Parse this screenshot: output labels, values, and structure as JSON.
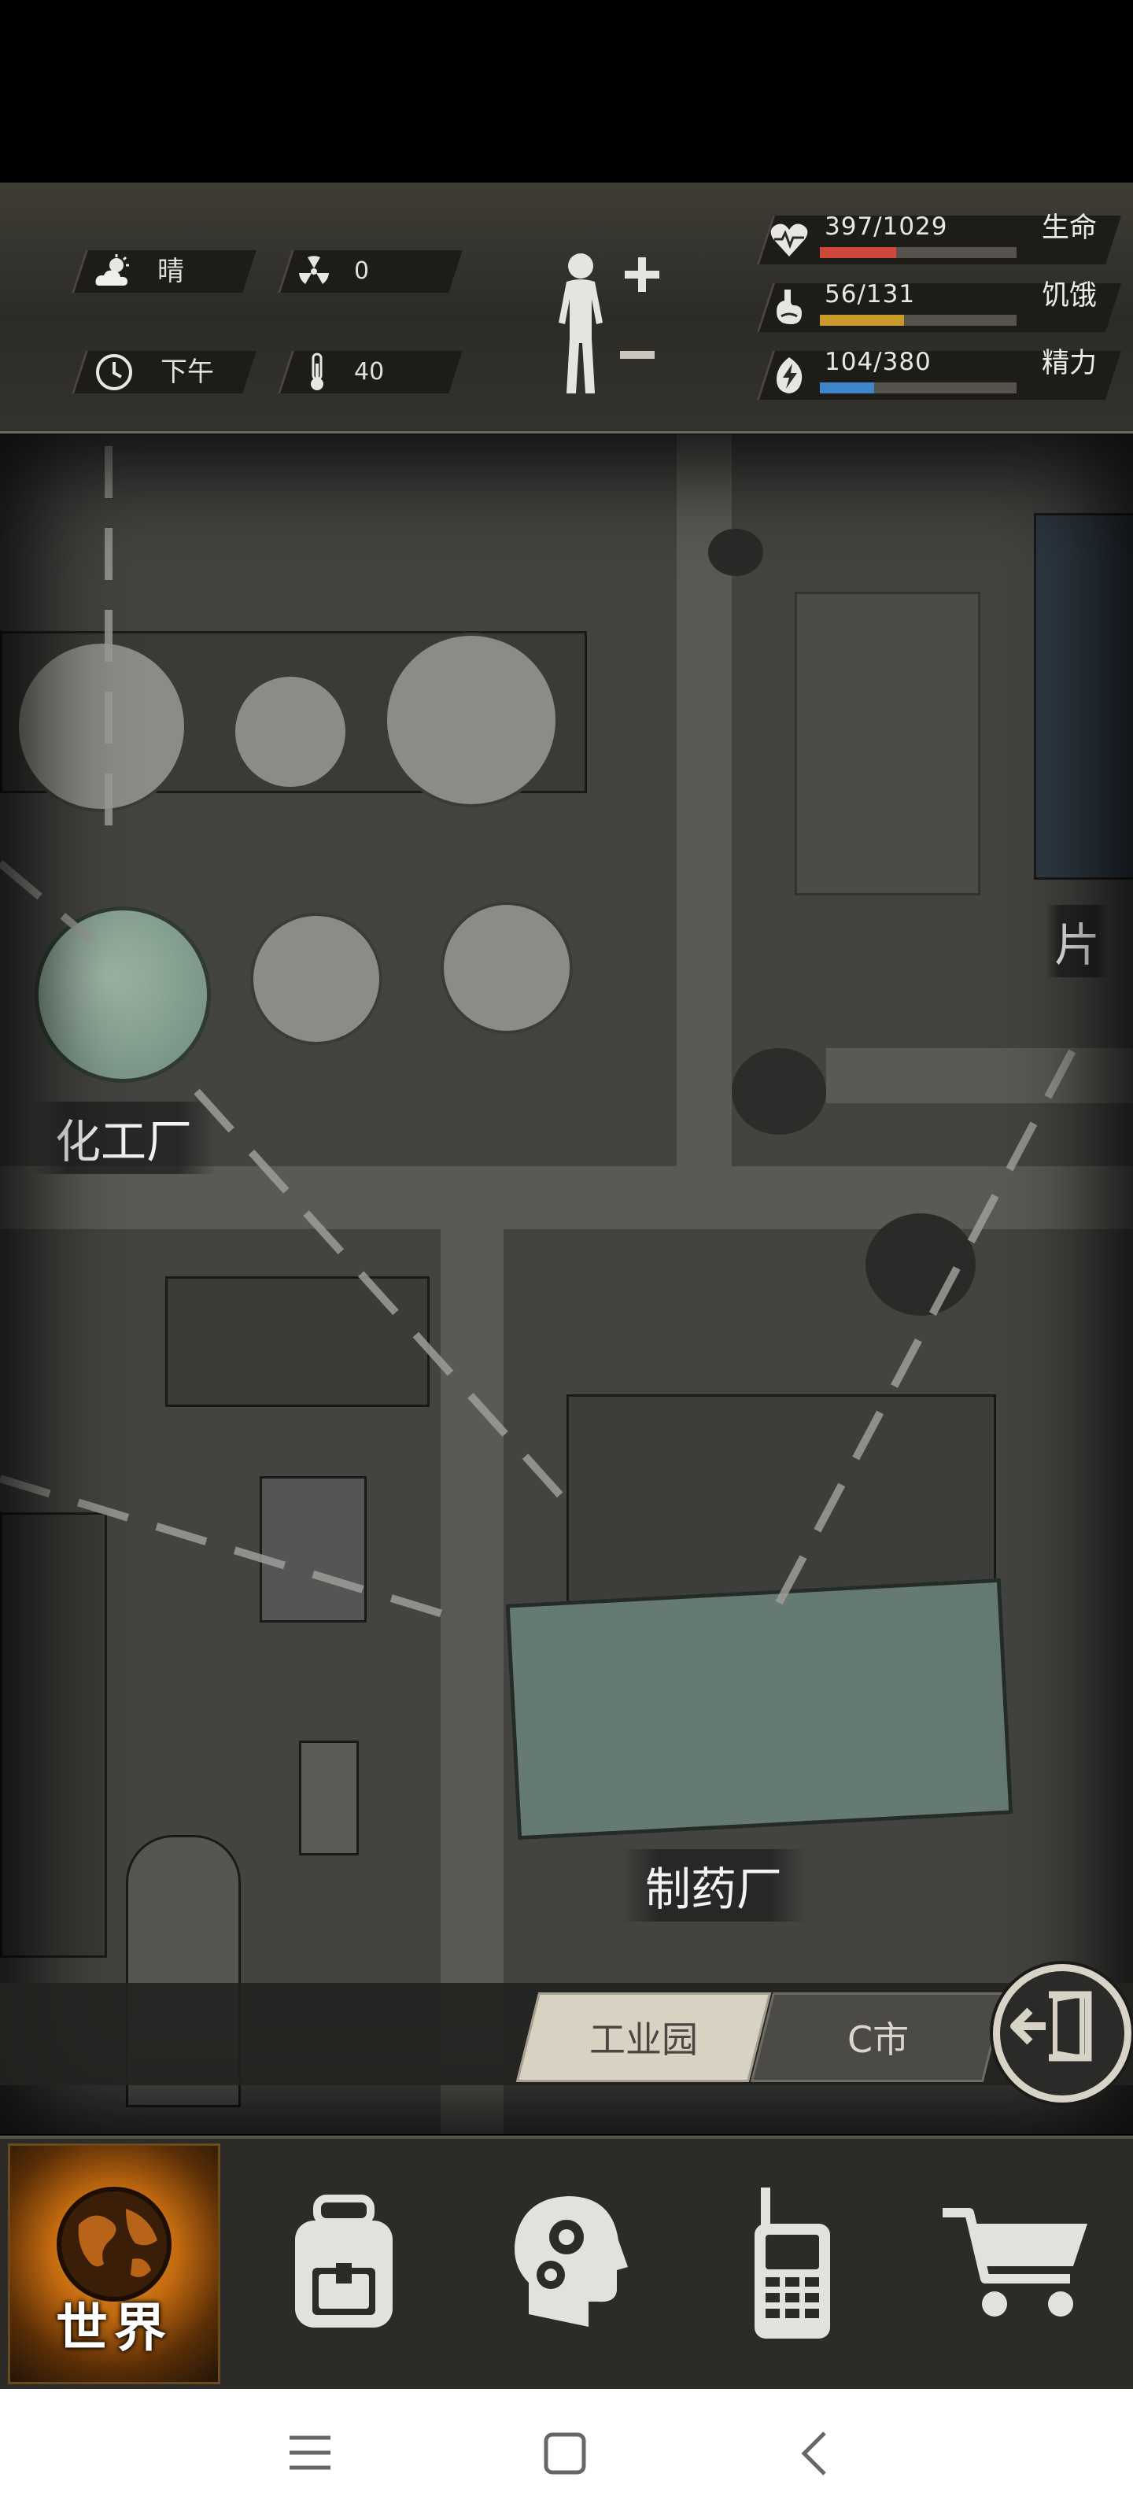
{
  "status": {
    "weather": {
      "icon": "cloud-sun-icon",
      "value": "晴"
    },
    "radiation": {
      "icon": "radiation-icon",
      "value": "0"
    },
    "time": {
      "icon": "clock-icon",
      "value": "下午"
    },
    "temperature": {
      "icon": "thermometer-icon",
      "value": "40"
    },
    "health": {
      "icon": "heart-icon",
      "text": "397/1029",
      "label": "生命",
      "fraction": 0.386,
      "color": "#d0473b"
    },
    "hunger": {
      "icon": "stomach-icon",
      "text": "56/131",
      "label": "饥饿",
      "fraction": 0.427,
      "color": "#c9992c"
    },
    "energy": {
      "icon": "energy-icon",
      "text": "104/380",
      "label": "精力",
      "fraction": 0.274,
      "color": "#3e86c9"
    }
  },
  "map": {
    "locations": [
      {
        "label": "化工厂"
      },
      {
        "label": "制药厂"
      },
      {
        "label": "片"
      }
    ]
  },
  "area": {
    "current": "工业园",
    "city": "C市"
  },
  "nav": {
    "world_label": "世界"
  }
}
